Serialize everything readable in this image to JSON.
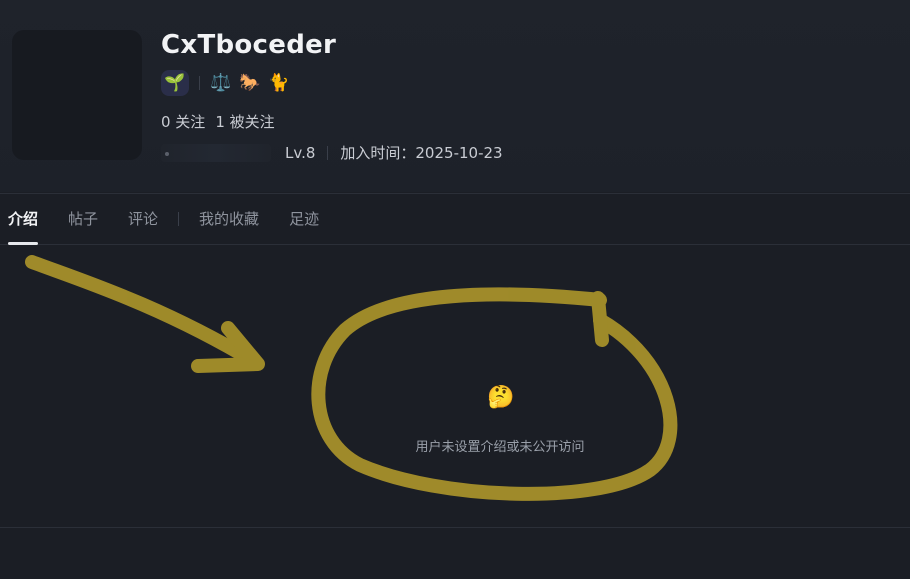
{
  "profile": {
    "username": "CxTboceder",
    "badges": [
      {
        "icon": "seedling-icon",
        "glyph": "🌱"
      },
      {
        "icon": "balance-scale-icon",
        "glyph": "⚖️"
      },
      {
        "icon": "horse-icon",
        "glyph": "🐎"
      },
      {
        "icon": "cat-icon",
        "glyph": "🐈"
      }
    ],
    "following": "0 关注",
    "followers": "1 被关注",
    "level": "Lv.8",
    "joined": "加入时间：2025-10-23"
  },
  "tabs": [
    {
      "label": "介绍",
      "active": true
    },
    {
      "label": "帖子",
      "active": false
    },
    {
      "label": "评论",
      "active": false
    },
    {
      "label": "我的收藏",
      "active": false
    },
    {
      "label": "足迹",
      "active": false
    }
  ],
  "empty_state": {
    "emoji": "🤔",
    "message": "用户未设置介绍或未公开访问"
  },
  "colors": {
    "background": "#1b1e25",
    "annotation": "#a6902a"
  }
}
